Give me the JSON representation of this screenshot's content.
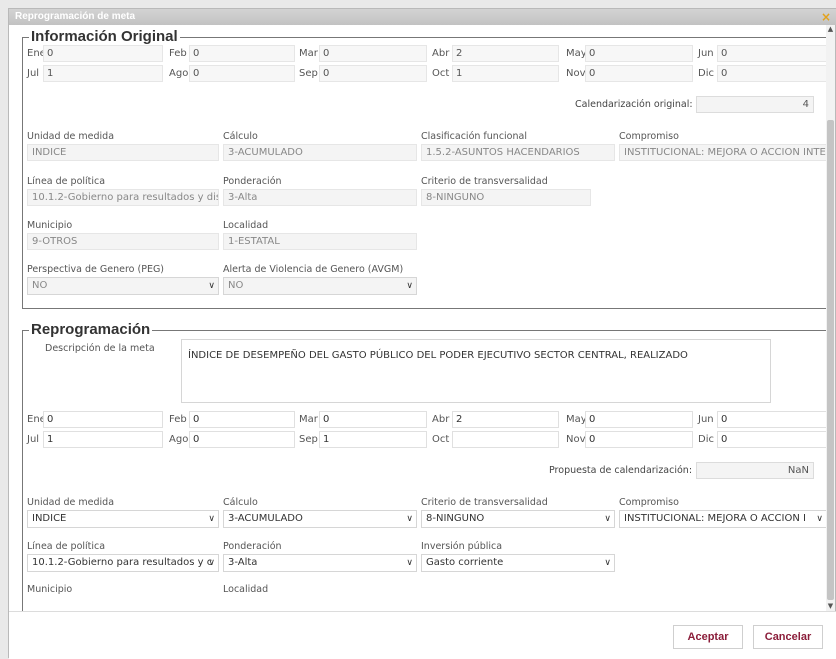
{
  "dialog": {
    "title": "Reprogramación de meta",
    "close": "×"
  },
  "original": {
    "legend": "Información Original",
    "months_row1": [
      {
        "label": "Ene",
        "value": "0"
      },
      {
        "label": "Feb",
        "value": "0"
      },
      {
        "label": "Mar",
        "value": "0"
      },
      {
        "label": "Abr",
        "value": "2"
      },
      {
        "label": "May",
        "value": "0"
      },
      {
        "label": "Jun",
        "value": "0"
      }
    ],
    "months_row2": [
      {
        "label": "Jul",
        "value": "1"
      },
      {
        "label": "Ago",
        "value": "0"
      },
      {
        "label": "Sep",
        "value": "0"
      },
      {
        "label": "Oct",
        "value": "1"
      },
      {
        "label": "Nov",
        "value": "0"
      },
      {
        "label": "Dic",
        "value": "0"
      }
    ],
    "cal_label": "Calendarización original:",
    "cal_value": "4",
    "unidad": {
      "label": "Unidad de medida",
      "value": "INDICE"
    },
    "calculo": {
      "label": "Cálculo",
      "value": "3-ACUMULADO"
    },
    "clasificacion": {
      "label": "Clasificación funcional",
      "value": "1.5.2-ASUNTOS HACENDARIOS"
    },
    "compromiso": {
      "label": "Compromiso",
      "value": "INSTITUCIONAL: MEJORA O ACCION INTE"
    },
    "linea": {
      "label": "Línea de política",
      "value": "10.1.2-Gobierno para resultados y disci"
    },
    "ponderacion": {
      "label": "Ponderación",
      "value": "3-Alta"
    },
    "criterio": {
      "label": "Criterio de transversalidad",
      "value": "8-NINGUNO"
    },
    "municipio": {
      "label": "Municipio",
      "value": "9-OTROS"
    },
    "localidad": {
      "label": "Localidad",
      "value": "1-ESTATAL"
    },
    "peg": {
      "label": "Perspectiva de Genero (PEG)",
      "value": "NO"
    },
    "avgm": {
      "label": "Alerta de Violencia de Genero (AVGM)",
      "value": "NO"
    }
  },
  "reprog": {
    "legend": "Reprogramación",
    "desc_label": "Descripción de la meta",
    "desc_value": "ÍNDICE DE DESEMPEÑO DEL GASTO PÚBLICO DEL PODER EJECUTIVO SECTOR CENTRAL, REALIZADO",
    "months_row1": [
      {
        "label": "Ene",
        "value": "0"
      },
      {
        "label": "Feb",
        "value": "0"
      },
      {
        "label": "Mar",
        "value": "0"
      },
      {
        "label": "Abr",
        "value": "2"
      },
      {
        "label": "May",
        "value": "0"
      },
      {
        "label": "Jun",
        "value": "0"
      }
    ],
    "months_row2": [
      {
        "label": "Jul",
        "value": "1"
      },
      {
        "label": "Ago",
        "value": "0"
      },
      {
        "label": "Sep",
        "value": "1"
      },
      {
        "label": "Oct",
        "value": ""
      },
      {
        "label": "Nov",
        "value": "0"
      },
      {
        "label": "Dic",
        "value": "0"
      }
    ],
    "cal_label": "Propuesta de calendarización:",
    "cal_value": "NaN",
    "unidad": {
      "label": "Unidad de medida",
      "value": "INDICE"
    },
    "calculo": {
      "label": "Cálculo",
      "value": "3-ACUMULADO"
    },
    "criterio": {
      "label": "Criterio de transversalidad",
      "value": "8-NINGUNO"
    },
    "compromiso": {
      "label": "Compromiso",
      "value": "INSTITUCIONAL: MEJORA O ACCION I"
    },
    "linea": {
      "label": "Línea de política",
      "value": "10.1.2-Gobierno para resultados y c"
    },
    "ponderacion": {
      "label": "Ponderación",
      "value": "3-Alta"
    },
    "inversion": {
      "label": "Inversión pública",
      "value": "Gasto corriente"
    },
    "municipio": {
      "label": "Municipio"
    },
    "localidad": {
      "label": "Localidad"
    }
  },
  "buttons": {
    "accept": "Aceptar",
    "cancel": "Cancelar"
  },
  "colors": {
    "accent": "#8b1d3a",
    "close": "#e3a21a"
  }
}
